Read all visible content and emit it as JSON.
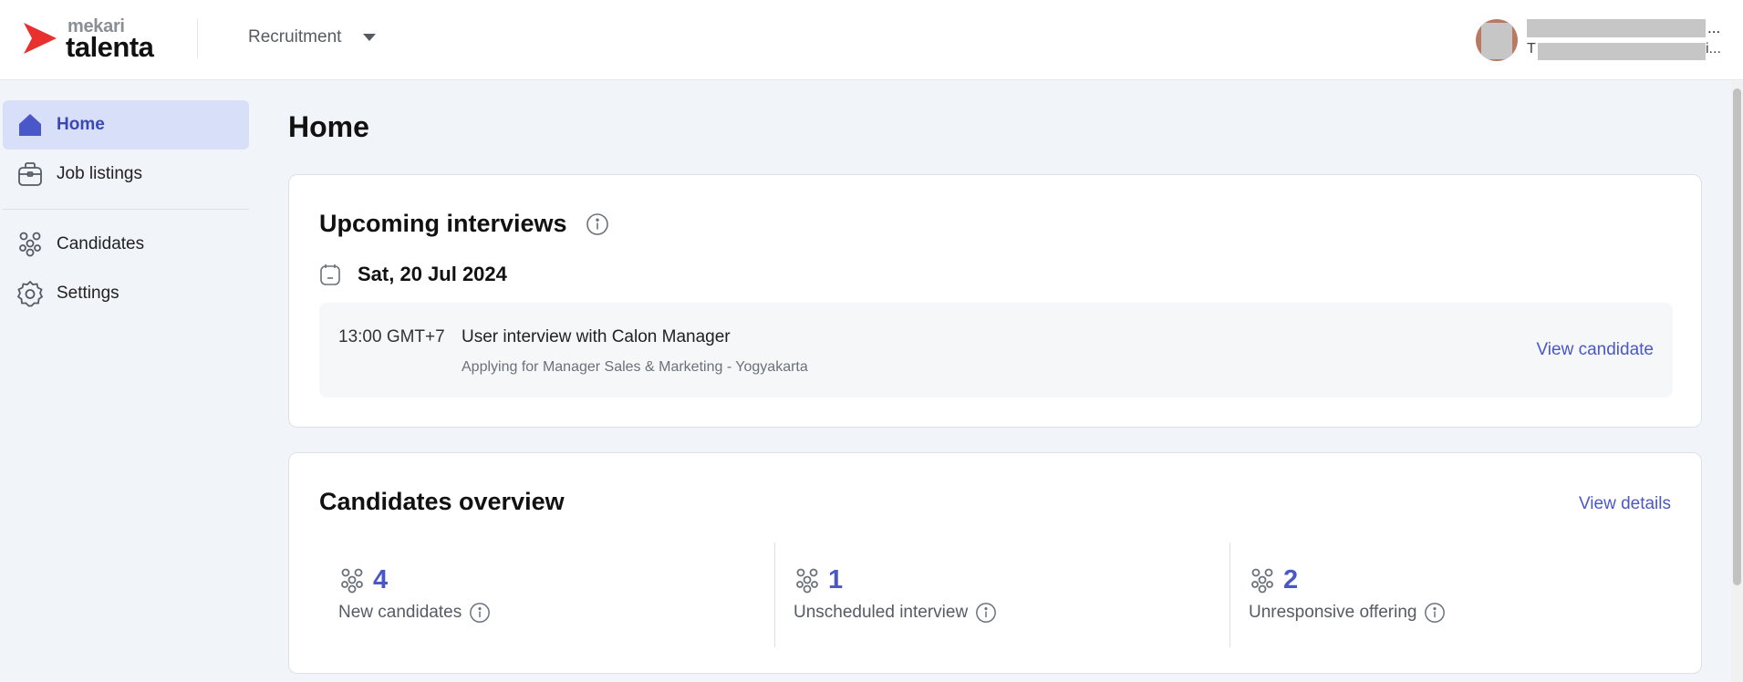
{
  "brand": {
    "small": "mekari",
    "big": "talenta",
    "accent": "#e8312f"
  },
  "topbar": {
    "module_label": "Recruitment"
  },
  "user": {
    "name_ellipsis": "...",
    "role_initial": "T",
    "role_ellipsis": "i..."
  },
  "sidebar": {
    "items": [
      {
        "label": "Home",
        "icon": "home-icon",
        "active": true
      },
      {
        "label": "Job listings",
        "icon": "briefcase-icon",
        "active": false
      },
      {
        "label": "Candidates",
        "icon": "people-icon",
        "active": false
      },
      {
        "label": "Settings",
        "icon": "gear-icon",
        "active": false
      }
    ]
  },
  "page": {
    "title": "Home"
  },
  "interviews": {
    "title": "Upcoming interviews",
    "date": "Sat, 20 Jul 2024",
    "items": [
      {
        "time": "13:00 GMT+7",
        "title": "User interview with Calon Manager",
        "subtitle": "Applying for Manager Sales & Marketing - Yogyakarta",
        "action": "View candidate"
      }
    ]
  },
  "overview": {
    "title": "Candidates overview",
    "action": "View details",
    "stats": [
      {
        "value": "4",
        "label": "New candidates"
      },
      {
        "value": "1",
        "label": "Unscheduled interview"
      },
      {
        "value": "2",
        "label": "Unresponsive offering"
      }
    ]
  },
  "colors": {
    "primary": "#4a57c8",
    "active_bg": "#d8dff9",
    "page_bg": "#f1f4f8"
  }
}
